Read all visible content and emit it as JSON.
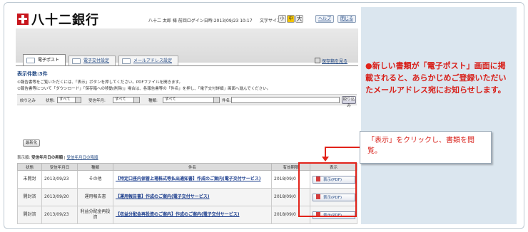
{
  "header": {
    "bank_name": "八十二銀行",
    "user_info": "八十二 太郎 様  前回ログイン日時:2013/09/23 10:17",
    "font_size_label": "文字サイズ",
    "font_sizes": [
      "小",
      "中",
      "大"
    ],
    "help": "ヘルプ",
    "close": "閉じる"
  },
  "tabs": [
    {
      "label": "電子ポスト",
      "active": true
    },
    {
      "label": "電子交付設定",
      "active": false
    },
    {
      "label": "メールアドレス設定",
      "active": false
    }
  ],
  "storage_link": "保存箱を見る",
  "count_label": "表示件数:3件",
  "notes": [
    "①報告書等をご覧いただくには、「表示」ボタンを押してください。PDFファイルを開きます。",
    "②報告書等について「ダウンロード」「保存箱への移動(削除)」場合は、各報告書等の「件名」を押し、「電子交付詳細」画面へ進んでください。"
  ],
  "filter": {
    "label": "絞り込み",
    "status_label": "状態:",
    "status_value": "すべて",
    "date_label": "受信年月:",
    "date_value": "すべて",
    "type_label": "種類:",
    "type_value": "すべて",
    "name_label": "件名:",
    "name_placeholder": "",
    "button": "絞り込み"
  },
  "refresh_button": "最新化",
  "sort": {
    "label": "表示順:",
    "current": "受信年月日の昇順",
    "link": "受信年月日の降順"
  },
  "table": {
    "headers": [
      "状態",
      "受信年月日",
      "種類",
      "件名",
      "有効期限",
      "表示"
    ],
    "rows": [
      {
        "status": "未開封",
        "date": "2013/09/23",
        "type": "その他",
        "subject": "【特定口座内保管上場株式等払出通知書】作成のご案内(電子交付サービス)",
        "expiry": "2018/09/0",
        "view": "表示(PDF)"
      },
      {
        "status": "開封済",
        "date": "2013/09/20",
        "type": "運用報告書",
        "subject": "【運用報告書】作成のご案内(電子交付サービス)",
        "expiry": "2018/09/0",
        "view": "表示(PDF)"
      },
      {
        "status": "開封済",
        "date": "2013/09/23",
        "type": "利益分配金再投資",
        "subject": "【収益分配金再投資のご案内】作成のご案内(電子交付サービス)",
        "expiry": "2018/09/0",
        "view": "表示(PDF)"
      }
    ]
  },
  "callout": "「表示」をクリックし、書類を閲覧。",
  "panel": {
    "bullet": "●",
    "text": "新しい書類が「電子ポスト」画面に掲載されると、あらかじめご登録いただいたメールアドレス宛にお知らせします。"
  },
  "colors": {
    "accent": "#e2231a",
    "panel_bg": "#dbe6ef",
    "link": "#244a84"
  }
}
